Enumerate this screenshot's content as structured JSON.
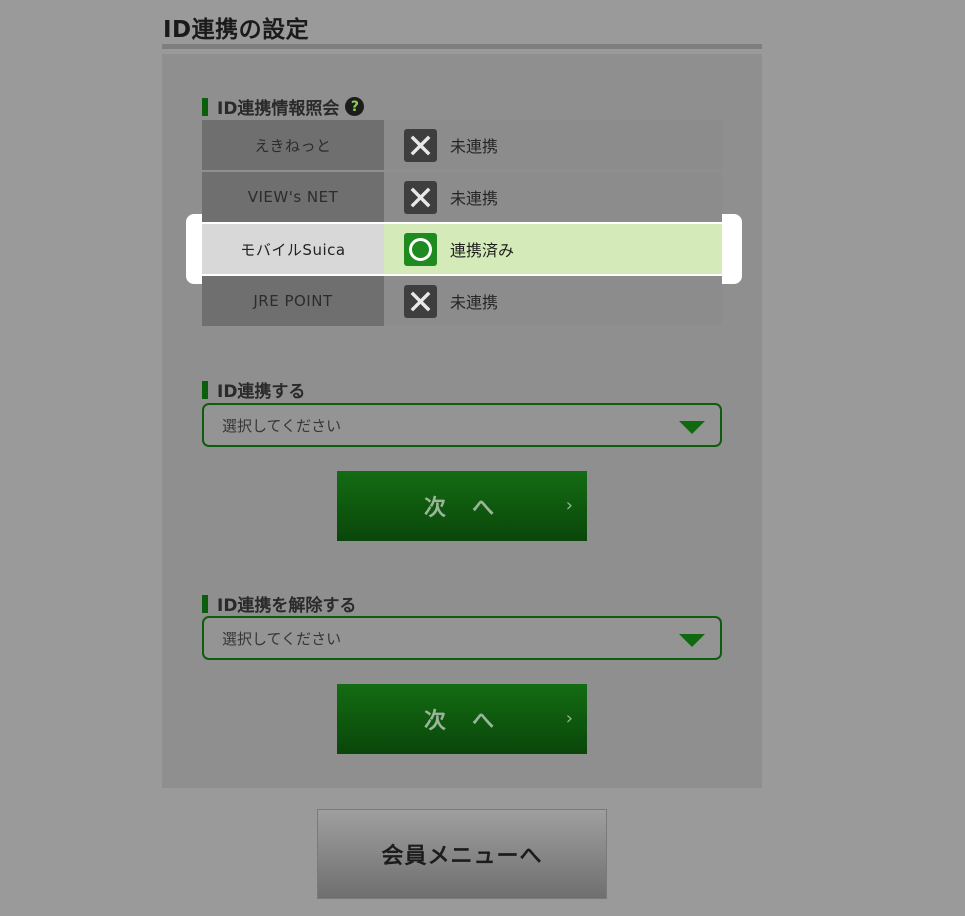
{
  "page": {
    "title": "ID連携の設定"
  },
  "status_section": {
    "heading": "ID連携情報照会",
    "help_icon": "?",
    "rows": [
      {
        "service": "えきねっと",
        "status": "未連携",
        "icon": "x-icon"
      },
      {
        "service": "VIEW's NET",
        "status": "未連携",
        "icon": "x-icon"
      },
      {
        "service": "モバイルSuica",
        "status": "連携済み",
        "icon": "circle-icon",
        "highlighted": true
      },
      {
        "service": "JRE POINT",
        "status": "未連携",
        "icon": "x-icon"
      }
    ]
  },
  "link_section": {
    "heading": "ID連携する",
    "select_value": "選択してください",
    "next_label": "次へ",
    "next_chevron": "›"
  },
  "unlink_section": {
    "heading": "ID連携を解除する",
    "select_value": "選択してください",
    "next_label": "次へ",
    "next_chevron": "›"
  },
  "footer": {
    "menu_button_label": "会員メニューへ"
  },
  "colors": {
    "accent_green": "#0b5e0b",
    "linked_bg": "#d4ebb9",
    "overlay_gray": "#9a9a9a"
  }
}
